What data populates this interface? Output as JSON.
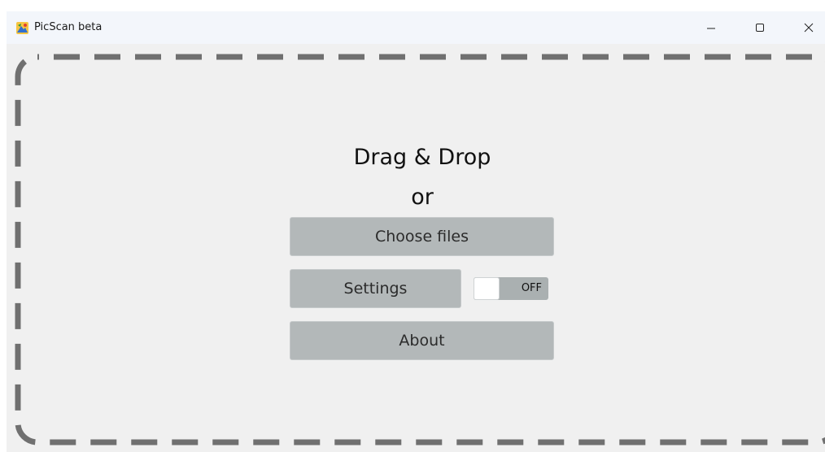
{
  "window": {
    "title": "PicScan beta",
    "controls": {
      "minimize": "minimize-icon",
      "maximize": "maximize-icon",
      "close": "close-icon"
    }
  },
  "drop_zone": {
    "heading": "Drag & Drop",
    "separator": "or",
    "border_color": "#707070"
  },
  "buttons": {
    "choose_files": "Choose files",
    "settings": "Settings",
    "about": "About"
  },
  "toggle": {
    "state_label": "OFF",
    "on": false
  },
  "colors": {
    "button_bg": "#b3b8b9",
    "window_bg": "#f0f0f0",
    "titlebar_bg": "#f3f6fb"
  }
}
